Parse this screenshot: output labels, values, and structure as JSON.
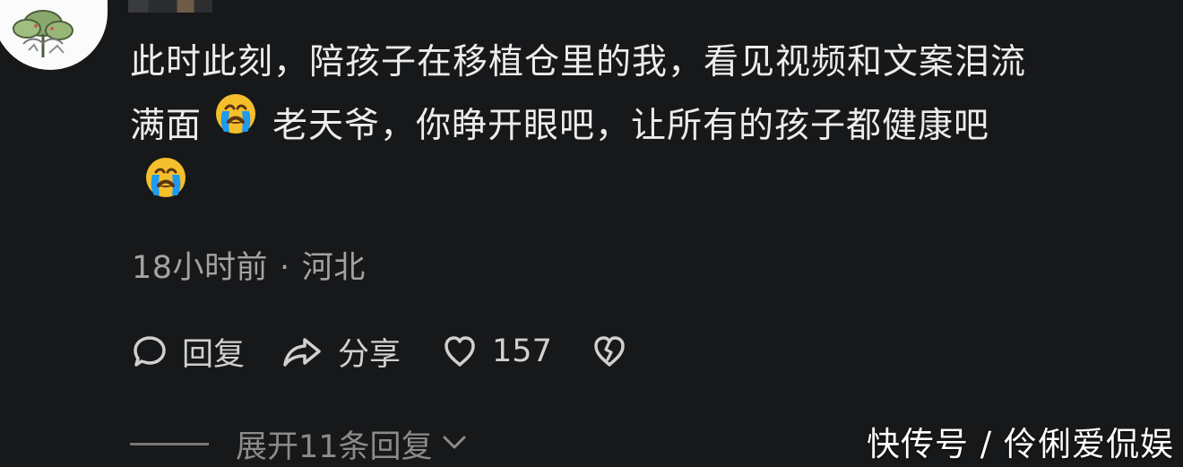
{
  "comment": {
    "lines": [
      "此时此刻，陪孩子在移植仓里的我，看见视频和文案泪流",
      "满面",
      "老天爷，你睁开眼吧，让所有的孩子都健康吧"
    ],
    "emoji": "loudly-crying-face-icon"
  },
  "meta": {
    "time": "18小时前",
    "separator": "·",
    "location": "河北"
  },
  "actions": {
    "reply_label": "回复",
    "share_label": "分享",
    "like_count": "157",
    "reply_icon": "chat-bubble-icon",
    "share_icon": "share-arrow-icon",
    "like_icon": "heart-outline-icon",
    "dislike_icon": "broken-heart-icon"
  },
  "replies": {
    "expand_label": "展开11条回复"
  },
  "watermark": {
    "text": "快传号 / 伶俐爱侃娱"
  },
  "colors": {
    "background": "#17181a",
    "text_primary": "#ececec",
    "text_secondary": "#a3a3a3",
    "emoji_yellow": "#f5bf2b",
    "emoji_tears": "#1d9bf0"
  }
}
